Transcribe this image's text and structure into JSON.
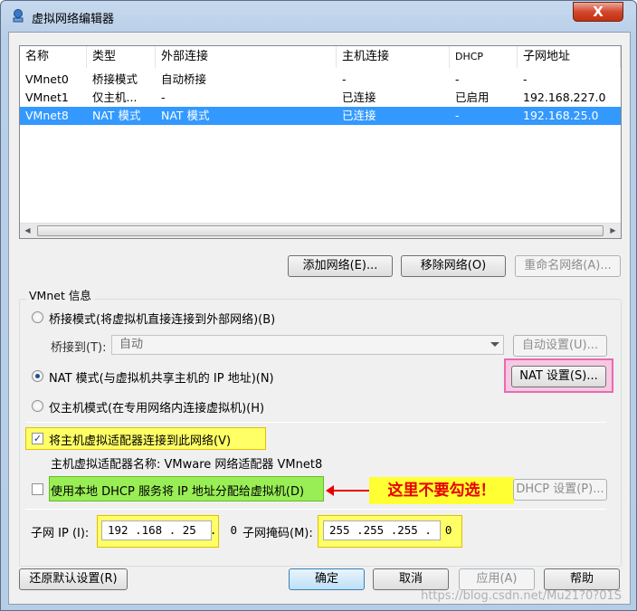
{
  "window": {
    "title": "虚拟网络编辑器",
    "close_label": "X"
  },
  "list": {
    "columns": [
      "名称",
      "类型",
      "外部连接",
      "主机连接",
      "DHCP",
      "子网地址"
    ],
    "rows": [
      [
        "VMnet0",
        "桥接模式",
        "自动桥接",
        "-",
        "-",
        "-"
      ],
      [
        "VMnet1",
        "仅主机...",
        "-",
        "已连接",
        "已启用",
        "192.168.227.0"
      ],
      [
        "VMnet8",
        "NAT 模式",
        "NAT 模式",
        "已连接",
        "-",
        "192.168.25.0"
      ]
    ],
    "selected_index": 2
  },
  "list_buttons": {
    "add": "添加网络(E)...",
    "remove": "移除网络(O)",
    "rename": "重命名网络(A)..."
  },
  "vmnet_info": {
    "group_label": "VMnet 信息",
    "bridge_radio": "桥接模式(将虚拟机直接连接到外部网络)(B)",
    "bridge_to_label": "桥接到(T):",
    "bridge_to_value": "自动",
    "auto_settings": "自动设置(U)...",
    "nat_radio": "NAT 模式(与虚拟机共享主机的 IP 地址)(N)",
    "nat_settings": "NAT 设置(S)...",
    "hostonly_radio": "仅主机模式(在专用网络内连接虚拟机)(H)",
    "connect_adapter": "将主机虚拟适配器连接到此网络(V)",
    "adapter_name": "主机虚拟适配器名称: VMware 网络适配器 VMnet8",
    "use_dhcp": "使用本地 DHCP 服务将 IP 地址分配给虚拟机(D)",
    "dhcp_settings": "DHCP 设置(P)...",
    "annotation": "这里不要勾选！",
    "subnet_ip_label": "子网 IP (I):",
    "subnet_ip_value": "192 .168 . 25  .  0",
    "subnet_mask_label": "子网掩码(M):",
    "subnet_mask_value": "255 .255 .255 .  0"
  },
  "footer": {
    "restore": "还原默认设置(R)",
    "ok": "确定",
    "cancel": "取消",
    "apply": "应用(A)",
    "help": "帮助"
  },
  "watermark": "https://blog.csdn.net/Mu21?0?01S",
  "colors": {
    "selection": "#3399ff",
    "annotation_text": "#e60000",
    "highlight_yellow": "#ffff66",
    "highlight_green": "#99ee55"
  }
}
